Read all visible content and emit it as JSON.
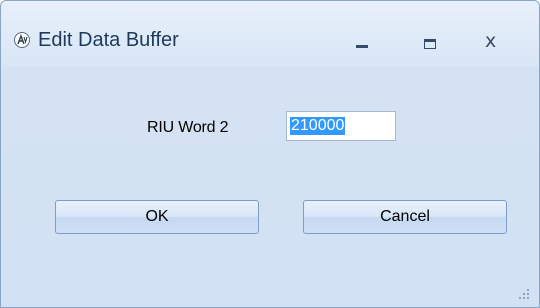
{
  "window": {
    "title": "Edit Data Buffer",
    "app_icon": "app-logo-icon",
    "controls": {
      "minimize": "minimize-icon",
      "maximize": "maximize-icon",
      "close_glyph": "x"
    }
  },
  "form": {
    "field_label": "RIU Word 2",
    "field_value": "210000",
    "field_selected": true
  },
  "buttons": {
    "ok_label": "OK",
    "cancel_label": "Cancel"
  },
  "colors": {
    "title_text": "#1e395b",
    "selection": "#3399ff",
    "client_background": "#d2e1f3"
  }
}
